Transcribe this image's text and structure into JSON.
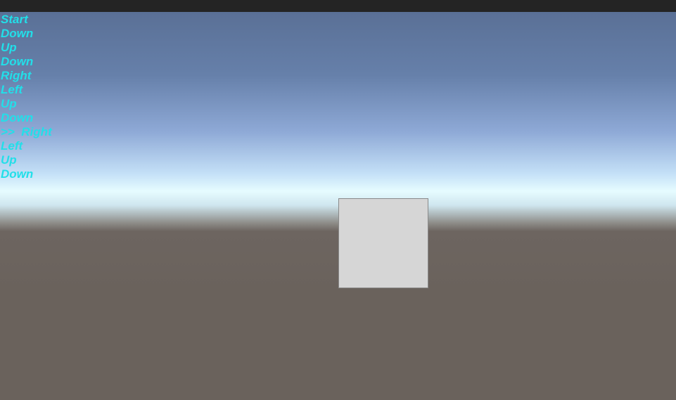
{
  "log": {
    "items": [
      "Start",
      "Down",
      "Up",
      "Down",
      "Right",
      "Left",
      "Up",
      "Down",
      ">>  Right",
      "Left",
      "Up",
      "Down"
    ],
    "text_color": "#22dfe9"
  },
  "scene": {
    "sky_color": "#5a7096",
    "horizon_color": "#e6fcff",
    "ground_color": "#6a625c",
    "cube_color": "#d6d6d6"
  }
}
